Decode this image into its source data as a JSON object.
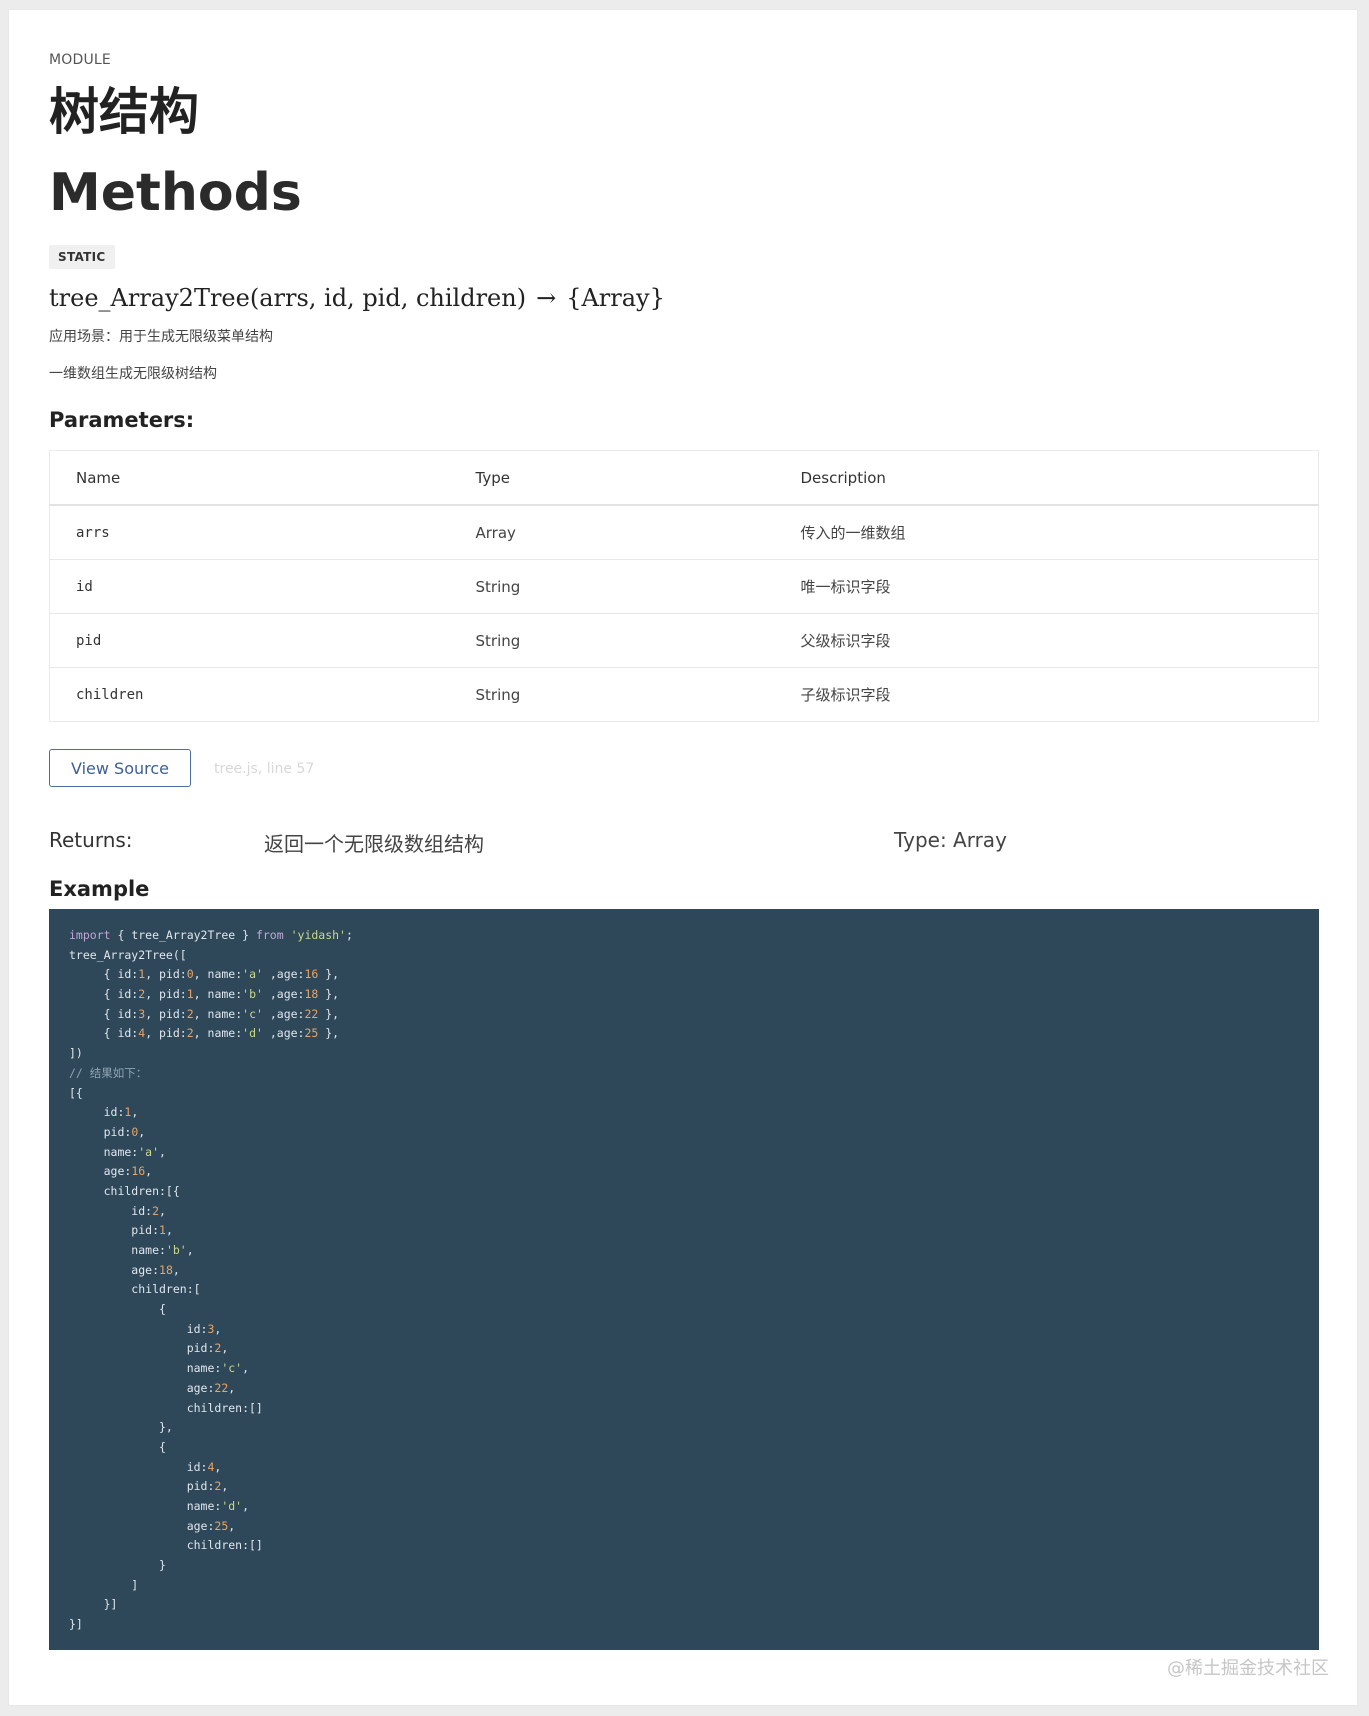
{
  "module": {
    "label": "MODULE",
    "title": "树结构"
  },
  "methods_title": "Methods",
  "method": {
    "badge": "STATIC",
    "signature": "tree_Array2Tree(arrs, id, pid, children)",
    "arrow": "→",
    "return_type": "{Array}",
    "desc_usage": "应用场景：用于生成无限级菜单结构",
    "desc_summary": "一维数组生成无限级树结构"
  },
  "parameters": {
    "title": "Parameters:",
    "headers": [
      "Name",
      "Type",
      "Description"
    ],
    "rows": [
      {
        "name": "arrs",
        "type": "Array",
        "description": "传入的一维数组"
      },
      {
        "name": "id",
        "type": "String",
        "description": "唯一标识字段"
      },
      {
        "name": "pid",
        "type": "String",
        "description": "父级标识字段"
      },
      {
        "name": "children",
        "type": "String",
        "description": "子级标识字段"
      }
    ]
  },
  "source": {
    "button_label": "View Source",
    "reference": "tree.js, line 57"
  },
  "returns": {
    "label": "Returns:",
    "description": "返回一个无限级数组结构",
    "type": "Type: Array"
  },
  "example": {
    "title": "Example",
    "code_lines": [
      [
        [
          "kw",
          "import"
        ],
        [
          "id",
          " { tree_Array2Tree } "
        ],
        [
          "kw",
          "from"
        ],
        [
          "id",
          " "
        ],
        [
          "str",
          "'yidash'"
        ],
        [
          "id",
          ";"
        ]
      ],
      [
        [
          "id",
          "tree_Array2Tree(["
        ]
      ],
      [
        [
          "id",
          "     { id:"
        ],
        [
          "num",
          "1"
        ],
        [
          "id",
          ", pid:"
        ],
        [
          "num",
          "0"
        ],
        [
          "id",
          ", name:"
        ],
        [
          "str",
          "'a'"
        ],
        [
          "id",
          " ,age:"
        ],
        [
          "num",
          "16"
        ],
        [
          "id",
          " },"
        ]
      ],
      [
        [
          "id",
          "     { id:"
        ],
        [
          "num",
          "2"
        ],
        [
          "id",
          ", pid:"
        ],
        [
          "num",
          "1"
        ],
        [
          "id",
          ", name:"
        ],
        [
          "str",
          "'b'"
        ],
        [
          "id",
          " ,age:"
        ],
        [
          "num",
          "18"
        ],
        [
          "id",
          " },"
        ]
      ],
      [
        [
          "id",
          "     { id:"
        ],
        [
          "num",
          "3"
        ],
        [
          "id",
          ", pid:"
        ],
        [
          "num",
          "2"
        ],
        [
          "id",
          ", name:"
        ],
        [
          "str",
          "'c'"
        ],
        [
          "id",
          " ,age:"
        ],
        [
          "num",
          "22"
        ],
        [
          "id",
          " },"
        ]
      ],
      [
        [
          "id",
          "     { id:"
        ],
        [
          "num",
          "4"
        ],
        [
          "id",
          ", pid:"
        ],
        [
          "num",
          "2"
        ],
        [
          "id",
          ", name:"
        ],
        [
          "str",
          "'d'"
        ],
        [
          "id",
          " ,age:"
        ],
        [
          "num",
          "25"
        ],
        [
          "id",
          " },"
        ]
      ],
      [
        [
          "id",
          "])"
        ]
      ],
      [
        [
          "cm",
          "// 结果如下："
        ]
      ],
      [
        [
          "id",
          "[{"
        ]
      ],
      [
        [
          "id",
          "     id:"
        ],
        [
          "num",
          "1"
        ],
        [
          "id",
          ","
        ]
      ],
      [
        [
          "id",
          "     pid:"
        ],
        [
          "num",
          "0"
        ],
        [
          "id",
          ","
        ]
      ],
      [
        [
          "id",
          "     name:"
        ],
        [
          "str",
          "'a'"
        ],
        [
          "id",
          ","
        ]
      ],
      [
        [
          "id",
          "     age:"
        ],
        [
          "num",
          "16"
        ],
        [
          "id",
          ","
        ]
      ],
      [
        [
          "id",
          "     children:[{"
        ]
      ],
      [
        [
          "id",
          "         id:"
        ],
        [
          "num",
          "2"
        ],
        [
          "id",
          ","
        ]
      ],
      [
        [
          "id",
          "         pid:"
        ],
        [
          "num",
          "1"
        ],
        [
          "id",
          ","
        ]
      ],
      [
        [
          "id",
          "         name:"
        ],
        [
          "str",
          "'b'"
        ],
        [
          "id",
          ","
        ]
      ],
      [
        [
          "id",
          "         age:"
        ],
        [
          "num",
          "18"
        ],
        [
          "id",
          ","
        ]
      ],
      [
        [
          "id",
          "         children:["
        ]
      ],
      [
        [
          "id",
          "             {"
        ]
      ],
      [
        [
          "id",
          "                 id:"
        ],
        [
          "num",
          "3"
        ],
        [
          "id",
          ","
        ]
      ],
      [
        [
          "id",
          "                 pid:"
        ],
        [
          "num",
          "2"
        ],
        [
          "id",
          ","
        ]
      ],
      [
        [
          "id",
          "                 name:"
        ],
        [
          "str",
          "'c'"
        ],
        [
          "id",
          ","
        ]
      ],
      [
        [
          "id",
          "                 age:"
        ],
        [
          "num",
          "22"
        ],
        [
          "id",
          ","
        ]
      ],
      [
        [
          "id",
          "                 children:[]"
        ]
      ],
      [
        [
          "id",
          "             },"
        ]
      ],
      [
        [
          "id",
          "             {"
        ]
      ],
      [
        [
          "id",
          "                 id:"
        ],
        [
          "num",
          "4"
        ],
        [
          "id",
          ","
        ]
      ],
      [
        [
          "id",
          "                 pid:"
        ],
        [
          "num",
          "2"
        ],
        [
          "id",
          ","
        ]
      ],
      [
        [
          "id",
          "                 name:"
        ],
        [
          "str",
          "'d'"
        ],
        [
          "id",
          ","
        ]
      ],
      [
        [
          "id",
          "                 age:"
        ],
        [
          "num",
          "25"
        ],
        [
          "id",
          ","
        ]
      ],
      [
        [
          "id",
          "                 children:[]"
        ]
      ],
      [
        [
          "id",
          "             }"
        ]
      ],
      [
        [
          "id",
          "         ]"
        ]
      ],
      [
        [
          "id",
          "     }]"
        ]
      ],
      [
        [
          "id",
          "}]"
        ]
      ]
    ]
  },
  "watermark": "@稀土掘金技术社区",
  "colors": {
    "code_background": "#2e4759",
    "keyword": "#c3a6d8",
    "string": "#c9d98a",
    "number": "#e6a56a",
    "comment": "#8fa4b3",
    "button_border": "#4a6fa5"
  }
}
